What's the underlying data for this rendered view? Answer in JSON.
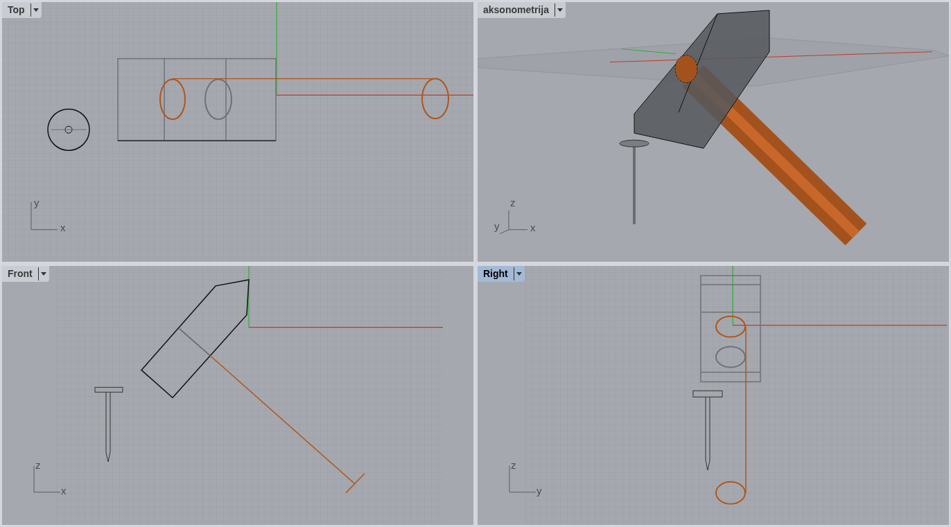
{
  "viewports": [
    {
      "title": "Top",
      "selected": false,
      "kind": "top",
      "axes": [
        "y",
        "x"
      ]
    },
    {
      "title": "aksonometrija",
      "selected": false,
      "kind": "perspective",
      "axes": [
        "z",
        "y",
        "x"
      ]
    },
    {
      "title": "Front",
      "selected": false,
      "kind": "front",
      "axes": [
        "z",
        "x"
      ]
    },
    {
      "title": "Right",
      "selected": true,
      "kind": "right",
      "axes": [
        "z",
        "y"
      ]
    }
  ]
}
